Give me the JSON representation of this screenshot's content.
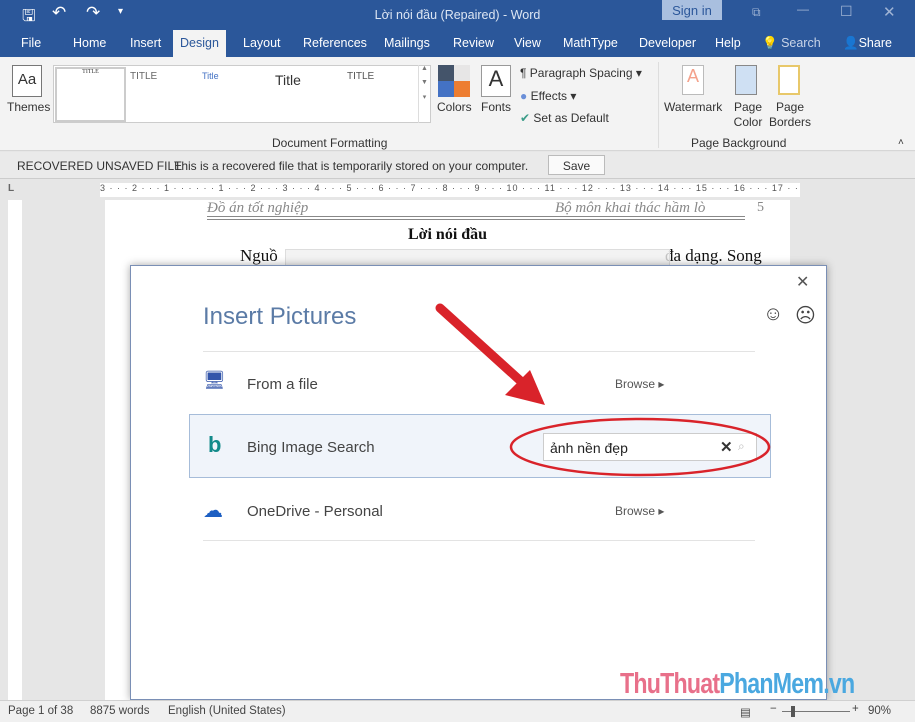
{
  "window": {
    "title": "Lời nói đầu (Repaired)  -  Word",
    "sign_in": "Sign in"
  },
  "tabs": [
    "File",
    "Home",
    "Insert",
    "Design",
    "Layout",
    "References",
    "Mailings",
    "Review",
    "View",
    "MathType",
    "Developer",
    "Help"
  ],
  "active_tab": "Design",
  "search_label": "Search",
  "share_label": "Share",
  "ribbon": {
    "themes": "Themes",
    "gallery": [
      "TITLE",
      "TITLE",
      "Title",
      "Title",
      "TITLE"
    ],
    "colors": "Colors",
    "fonts": "Fonts",
    "paragraph_spacing": "Paragraph Spacing",
    "effects": "Effects",
    "set_default": "Set as Default",
    "group_doc": "Document Formatting",
    "watermark": "Watermark",
    "page_color": "Page Color",
    "page_borders": "Page Borders",
    "group_bg": "Page Background"
  },
  "recovered": {
    "label": "RECOVERED UNSAVED FILE",
    "message": "This is a recovered file that is temporarily stored on your computer.",
    "save": "Save"
  },
  "ruler": "3 · · · 2 · · · 1 · · · · · · 1 · · · 2 · · · 3 · · · 4 · · · 5 · · · 6 · · · 7 · · · 8 · · · 9 · · · 10 · · · 11 · · · 12 · · · 13 · · · 14 · · · 15 · · · 16 · · · 17 · ·",
  "document": {
    "header_left": "Đồ án tốt nghiệp",
    "header_right": "Bộ môn khai thác hầm lò",
    "page_num": "5",
    "heading": "Lời nói đầu",
    "line_start": "Nguồ",
    "line_end": "đa dạng. Song"
  },
  "dialog": {
    "title": "Insert Pictures",
    "rows": [
      {
        "label": "From a file",
        "action": "Browse",
        "icon": "computer-icon"
      },
      {
        "label": "Bing Image Search",
        "icon": "bing-icon",
        "search_value": "ảnh nền đẹp"
      },
      {
        "label": "OneDrive - Personal",
        "action": "Browse",
        "icon": "onedrive-icon"
      }
    ]
  },
  "status": {
    "page": "Page 1 of 38",
    "words": "8875 words",
    "language": "English (United States)",
    "zoom": "90%"
  },
  "watermark": {
    "part1": "ThuThuat",
    "part2": "PhanMem.vn"
  },
  "colors": {
    "word_blue": "#2b579a",
    "annotation_red": "#d9232a"
  }
}
